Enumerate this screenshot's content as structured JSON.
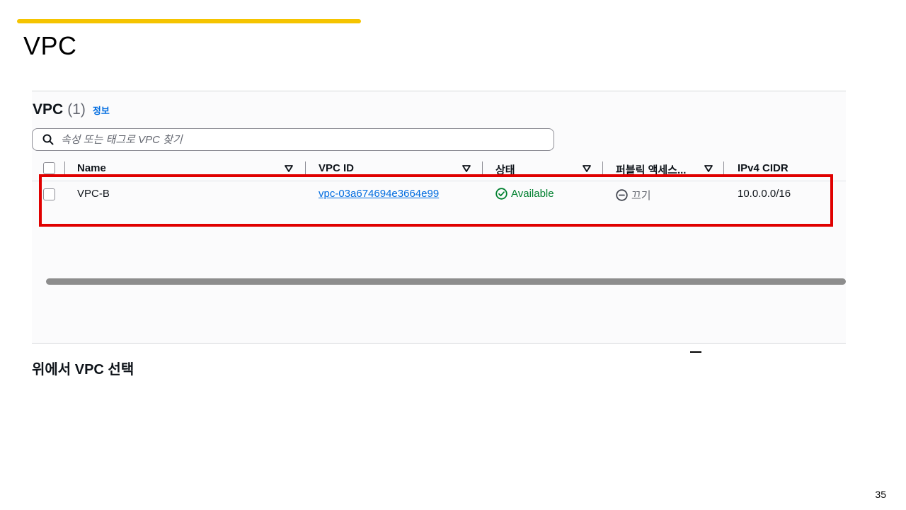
{
  "slide": {
    "title": "VPC",
    "page_number": "35",
    "accent_color": "#f5c400"
  },
  "panel": {
    "title": "VPC",
    "count": "(1)",
    "info_link": "정보",
    "search_placeholder": "속성 또는 태그로 VPC 찾기",
    "search_icon": "search-icon"
  },
  "table": {
    "columns": [
      "Name",
      "VPC ID",
      "상태",
      "퍼블릭 액세스...",
      "IPv4 CIDR"
    ],
    "rows": [
      {
        "name": "VPC-B",
        "vpc_id": "vpc-03a674694e3664e99",
        "status": "Available",
        "public_access": "끄기",
        "ipv4_cidr": "10.0.0.0/16"
      }
    ]
  },
  "detail": {
    "title": "위에서 VPC 선택"
  },
  "colors": {
    "highlight": "#e00000",
    "link": "#006ce0",
    "status_available": "#00802f"
  }
}
